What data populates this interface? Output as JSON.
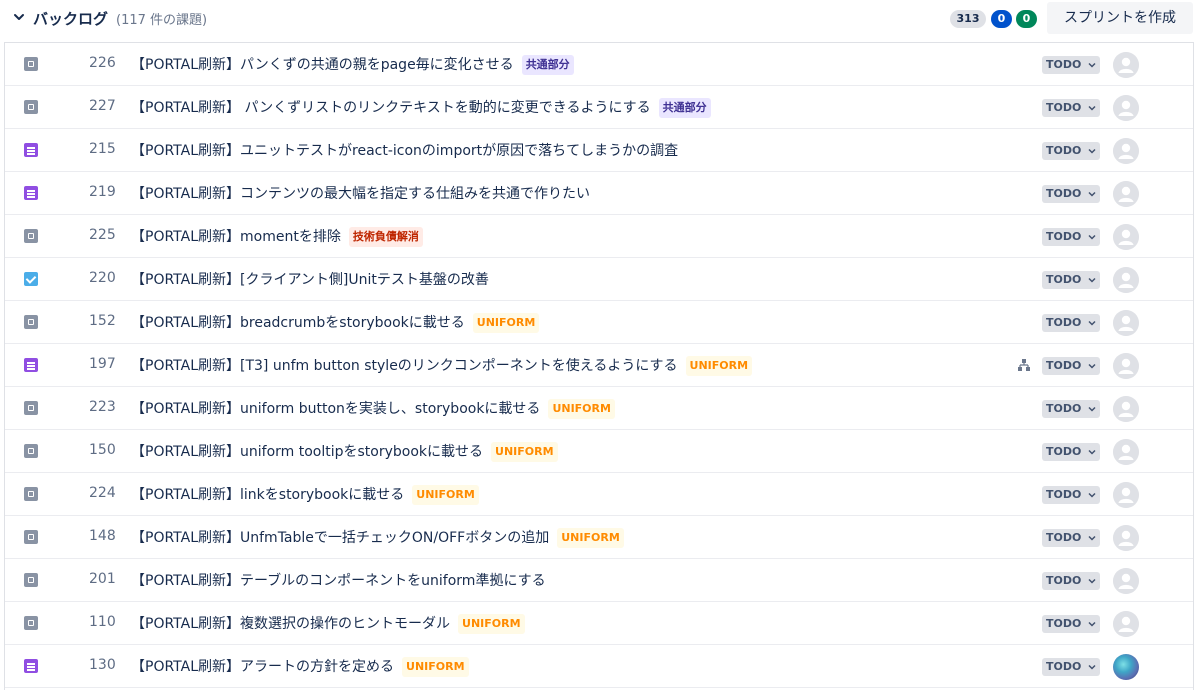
{
  "header": {
    "title": "バックログ",
    "count_text": "(117 件の課題)",
    "counts": {
      "total": "313",
      "in_progress": "0",
      "done": "0"
    },
    "create_sprint_label": "スプリントを作成"
  },
  "colors": {
    "task": "#8993a4",
    "story": "#904ee2",
    "check": "#4bade8"
  },
  "issues": [
    {
      "type": "task-icon",
      "key": "226",
      "summary": "【PORTAL刷新】パンくずの共通の親をpage毎に変化させる",
      "label": "共通部分",
      "label_style": "common",
      "status": "TODO"
    },
    {
      "type": "task-icon",
      "key": "227",
      "summary": "【PORTAL刷新】 パンくずリストのリンクテキストを動的に変更できるようにする",
      "label": "共通部分",
      "label_style": "common",
      "status": "TODO"
    },
    {
      "type": "story-icon",
      "key": "215",
      "summary": "【PORTAL刷新】ユニットテストがreact-iconのimportが原因で落ちてしまうかの調査",
      "label": "",
      "label_style": "",
      "status": "TODO"
    },
    {
      "type": "story-icon",
      "key": "219",
      "summary": "【PORTAL刷新】コンテンツの最大幅を指定する仕組みを共通で作りたい",
      "label": "",
      "label_style": "",
      "status": "TODO"
    },
    {
      "type": "task-icon",
      "key": "225",
      "summary": "【PORTAL刷新】momentを排除",
      "label": "技術負債解消",
      "label_style": "debt",
      "status": "TODO"
    },
    {
      "type": "check-icon",
      "key": "220",
      "summary": "【PORTAL刷新】[クライアント側]Unitテスト基盤の改善",
      "label": "",
      "label_style": "",
      "status": "TODO"
    },
    {
      "type": "task-icon",
      "key": "152",
      "summary": "【PORTAL刷新】breadcrumbをstorybookに載せる",
      "label": "UNIFORM",
      "label_style": "uniform",
      "status": "TODO"
    },
    {
      "type": "story-icon",
      "key": "197",
      "summary": "【PORTAL刷新】[T3] unfm button styleのリンクコンポーネントを使えるようにする",
      "label": "UNIFORM",
      "label_style": "uniform",
      "status": "TODO",
      "has_child": true
    },
    {
      "type": "task-icon",
      "key": "223",
      "summary": "【PORTAL刷新】uniform buttonを実装し、storybookに載せる",
      "label": "UNIFORM",
      "label_style": "uniform",
      "status": "TODO"
    },
    {
      "type": "task-icon",
      "key": "150",
      "summary": "【PORTAL刷新】uniform tooltipをstorybookに載せる",
      "label": "UNIFORM",
      "label_style": "uniform",
      "status": "TODO"
    },
    {
      "type": "task-icon",
      "key": "224",
      "summary": "【PORTAL刷新】linkをstorybookに載せる",
      "label": "UNIFORM",
      "label_style": "uniform",
      "status": "TODO"
    },
    {
      "type": "task-icon",
      "key": "148",
      "summary": "【PORTAL刷新】UnfmTableで一括チェックON/OFFボタンの追加",
      "label": "UNIFORM",
      "label_style": "uniform",
      "status": "TODO"
    },
    {
      "type": "task-icon",
      "key": "201",
      "summary": "【PORTAL刷新】テーブルのコンポーネントをuniform準拠にする",
      "label": "",
      "label_style": "",
      "status": "TODO"
    },
    {
      "type": "task-icon",
      "key": "110",
      "summary": "【PORTAL刷新】複数選択の操作のヒントモーダル",
      "label": "UNIFORM",
      "label_style": "uniform",
      "status": "TODO"
    },
    {
      "type": "story-icon",
      "key": "130",
      "summary": "【PORTAL刷新】アラートの方針を定める",
      "label": "UNIFORM",
      "label_style": "uniform",
      "status": "TODO",
      "avatar": "custom"
    }
  ]
}
